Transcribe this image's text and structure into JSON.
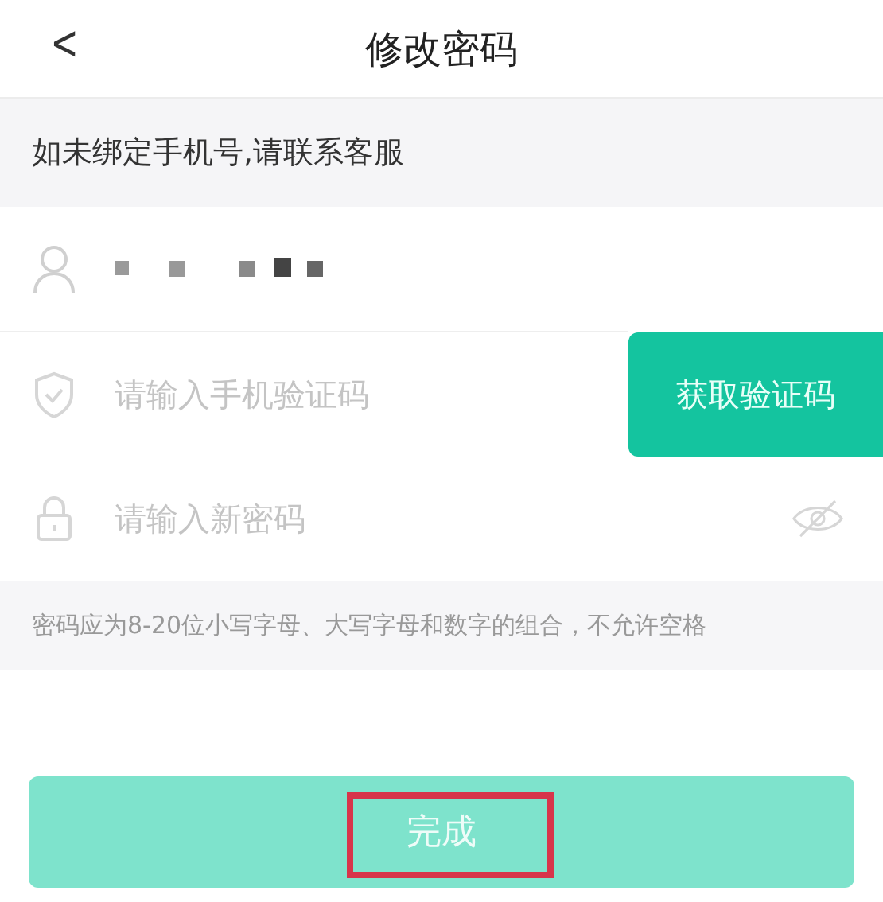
{
  "header": {
    "back": "<",
    "title": "修改密码"
  },
  "notice": "如未绑定手机号,请联系客服",
  "fields": [
    {
      "kind": "account",
      "masked": true
    },
    {
      "kind": "code",
      "placeholder": "请输入手机验证码",
      "button": "获取验证码"
    },
    {
      "kind": "password",
      "placeholder": "请输入新密码",
      "password_visible": false
    }
  ],
  "hint": "密码应为8-20位小写字母、大写字母和数字的组合，不允许空格",
  "done_button": {
    "label": "完成",
    "disabled": true,
    "highlighted": true
  }
}
